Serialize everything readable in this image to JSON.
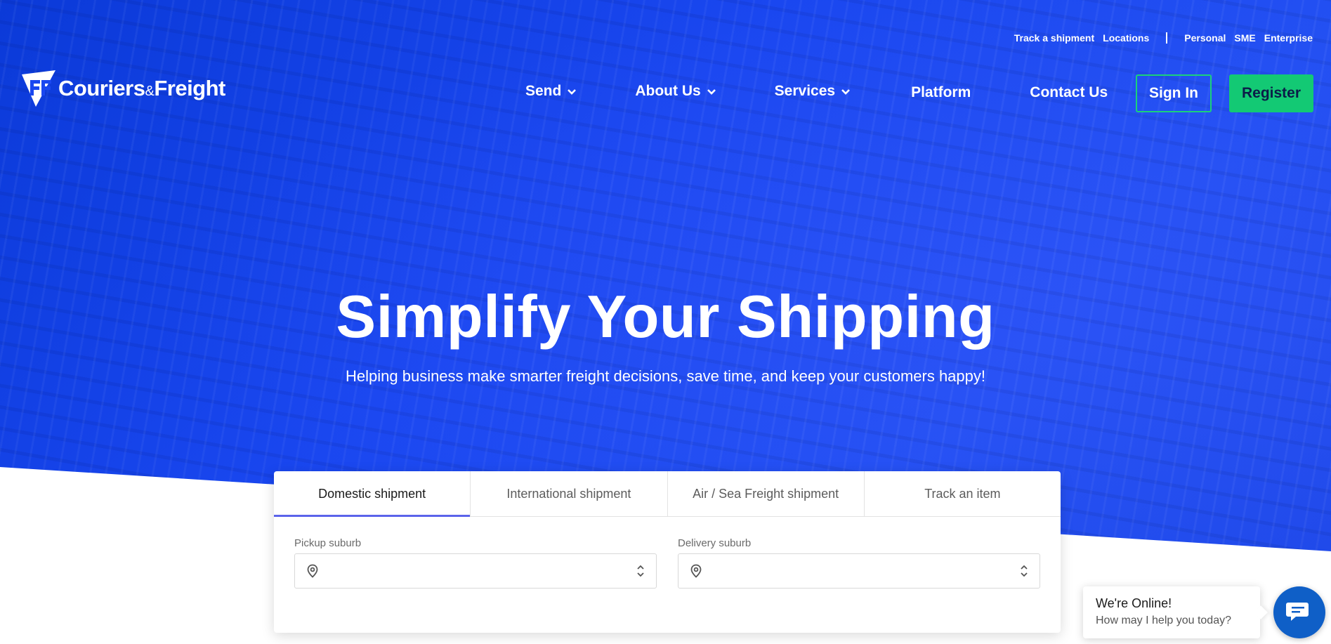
{
  "brand": {
    "name_part1": "Couriers",
    "name_amp": "&",
    "name_part2": "Freight",
    "logo_icon": "cf-logo-icon"
  },
  "topbar": {
    "links": [
      "Track a shipment",
      "Locations"
    ],
    "segments": [
      "Personal",
      "SME",
      "Enterprise"
    ]
  },
  "nav": {
    "items": [
      {
        "label": "Send",
        "has_dropdown": true
      },
      {
        "label": "About Us",
        "has_dropdown": true
      },
      {
        "label": "Services",
        "has_dropdown": true
      },
      {
        "label": "Platform",
        "has_dropdown": false
      },
      {
        "label": "Contact Us",
        "has_dropdown": false
      }
    ],
    "sign_in": "Sign In",
    "register": "Register"
  },
  "hero": {
    "headline": "Simplify Your Shipping",
    "subline": "Helping business make smarter freight decisions, save time, and keep your customers happy!"
  },
  "quote_card": {
    "tabs": [
      {
        "label": "Domestic shipment",
        "active": true
      },
      {
        "label": "International shipment",
        "active": false
      },
      {
        "label": "Air / Sea Freight shipment",
        "active": false
      },
      {
        "label": "Track an item",
        "active": false
      }
    ],
    "pickup": {
      "label": "Pickup suburb",
      "value": "",
      "placeholder": ""
    },
    "delivery": {
      "label": "Delivery suburb",
      "value": "",
      "placeholder": ""
    }
  },
  "chat": {
    "title": "We're Online!",
    "message": "How may I help you today?"
  },
  "colors": {
    "hero_blue": "#1a47f0",
    "accent_green": "#13c974",
    "tab_active_underline": "#5b63ea",
    "chat_blue": "#0f5fc7"
  }
}
